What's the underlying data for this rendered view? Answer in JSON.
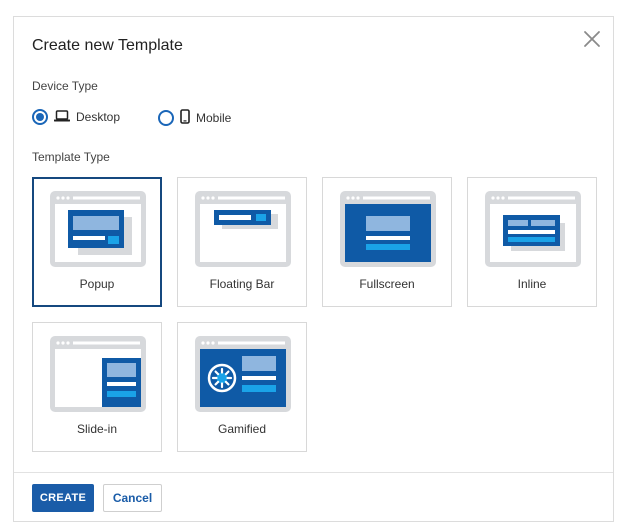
{
  "dialog": {
    "title": "Create new Template",
    "close_icon": "close-icon"
  },
  "device_type": {
    "label": "Device Type",
    "options": [
      {
        "label": "Desktop",
        "icon": "laptop-icon",
        "selected": true
      },
      {
        "label": "Mobile",
        "icon": "phone-icon",
        "selected": false
      }
    ]
  },
  "template_type": {
    "label": "Template Type",
    "cards": [
      {
        "label": "Popup",
        "icon": "popup-layout-icon",
        "selected": true
      },
      {
        "label": "Floating Bar",
        "icon": "floating-bar-layout-icon",
        "selected": false
      },
      {
        "label": "Fullscreen",
        "icon": "fullscreen-layout-icon",
        "selected": false
      },
      {
        "label": "Inline",
        "icon": "inline-layout-icon",
        "selected": false
      },
      {
        "label": "Slide-in",
        "icon": "slide-in-layout-icon",
        "selected": false
      },
      {
        "label": "Gamified",
        "icon": "gamified-layout-icon",
        "selected": false
      }
    ]
  },
  "footer": {
    "create_label": "CREATE",
    "cancel_label": "Cancel"
  },
  "colors": {
    "accent": "#1a5ca8",
    "dark_blue": "#0f5aa6",
    "light_blue": "#8fb6df",
    "cyan": "#1aa3e8",
    "frame_gray": "#d7d9dc"
  }
}
